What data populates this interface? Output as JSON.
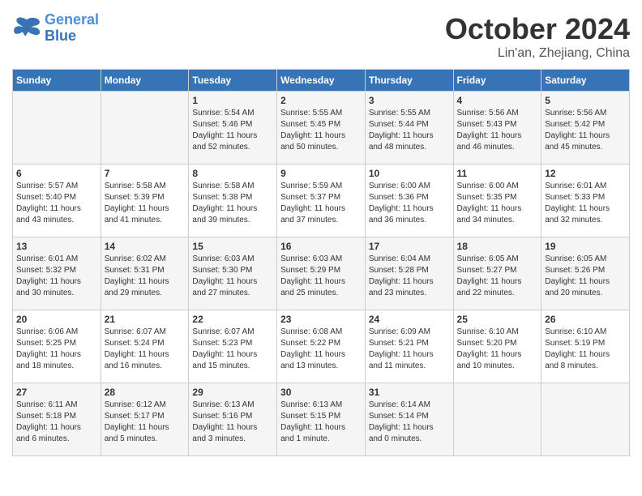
{
  "header": {
    "logo_line1": "General",
    "logo_line2": "Blue",
    "month": "October 2024",
    "location": "Lin'an, Zhejiang, China"
  },
  "days_of_week": [
    "Sunday",
    "Monday",
    "Tuesday",
    "Wednesday",
    "Thursday",
    "Friday",
    "Saturday"
  ],
  "weeks": [
    [
      {
        "day": "",
        "info": ""
      },
      {
        "day": "",
        "info": ""
      },
      {
        "day": "1",
        "info": "Sunrise: 5:54 AM\nSunset: 5:46 PM\nDaylight: 11 hours\nand 52 minutes."
      },
      {
        "day": "2",
        "info": "Sunrise: 5:55 AM\nSunset: 5:45 PM\nDaylight: 11 hours\nand 50 minutes."
      },
      {
        "day": "3",
        "info": "Sunrise: 5:55 AM\nSunset: 5:44 PM\nDaylight: 11 hours\nand 48 minutes."
      },
      {
        "day": "4",
        "info": "Sunrise: 5:56 AM\nSunset: 5:43 PM\nDaylight: 11 hours\nand 46 minutes."
      },
      {
        "day": "5",
        "info": "Sunrise: 5:56 AM\nSunset: 5:42 PM\nDaylight: 11 hours\nand 45 minutes."
      }
    ],
    [
      {
        "day": "6",
        "info": "Sunrise: 5:57 AM\nSunset: 5:40 PM\nDaylight: 11 hours\nand 43 minutes."
      },
      {
        "day": "7",
        "info": "Sunrise: 5:58 AM\nSunset: 5:39 PM\nDaylight: 11 hours\nand 41 minutes."
      },
      {
        "day": "8",
        "info": "Sunrise: 5:58 AM\nSunset: 5:38 PM\nDaylight: 11 hours\nand 39 minutes."
      },
      {
        "day": "9",
        "info": "Sunrise: 5:59 AM\nSunset: 5:37 PM\nDaylight: 11 hours\nand 37 minutes."
      },
      {
        "day": "10",
        "info": "Sunrise: 6:00 AM\nSunset: 5:36 PM\nDaylight: 11 hours\nand 36 minutes."
      },
      {
        "day": "11",
        "info": "Sunrise: 6:00 AM\nSunset: 5:35 PM\nDaylight: 11 hours\nand 34 minutes."
      },
      {
        "day": "12",
        "info": "Sunrise: 6:01 AM\nSunset: 5:33 PM\nDaylight: 11 hours\nand 32 minutes."
      }
    ],
    [
      {
        "day": "13",
        "info": "Sunrise: 6:01 AM\nSunset: 5:32 PM\nDaylight: 11 hours\nand 30 minutes."
      },
      {
        "day": "14",
        "info": "Sunrise: 6:02 AM\nSunset: 5:31 PM\nDaylight: 11 hours\nand 29 minutes."
      },
      {
        "day": "15",
        "info": "Sunrise: 6:03 AM\nSunset: 5:30 PM\nDaylight: 11 hours\nand 27 minutes."
      },
      {
        "day": "16",
        "info": "Sunrise: 6:03 AM\nSunset: 5:29 PM\nDaylight: 11 hours\nand 25 minutes."
      },
      {
        "day": "17",
        "info": "Sunrise: 6:04 AM\nSunset: 5:28 PM\nDaylight: 11 hours\nand 23 minutes."
      },
      {
        "day": "18",
        "info": "Sunrise: 6:05 AM\nSunset: 5:27 PM\nDaylight: 11 hours\nand 22 minutes."
      },
      {
        "day": "19",
        "info": "Sunrise: 6:05 AM\nSunset: 5:26 PM\nDaylight: 11 hours\nand 20 minutes."
      }
    ],
    [
      {
        "day": "20",
        "info": "Sunrise: 6:06 AM\nSunset: 5:25 PM\nDaylight: 11 hours\nand 18 minutes."
      },
      {
        "day": "21",
        "info": "Sunrise: 6:07 AM\nSunset: 5:24 PM\nDaylight: 11 hours\nand 16 minutes."
      },
      {
        "day": "22",
        "info": "Sunrise: 6:07 AM\nSunset: 5:23 PM\nDaylight: 11 hours\nand 15 minutes."
      },
      {
        "day": "23",
        "info": "Sunrise: 6:08 AM\nSunset: 5:22 PM\nDaylight: 11 hours\nand 13 minutes."
      },
      {
        "day": "24",
        "info": "Sunrise: 6:09 AM\nSunset: 5:21 PM\nDaylight: 11 hours\nand 11 minutes."
      },
      {
        "day": "25",
        "info": "Sunrise: 6:10 AM\nSunset: 5:20 PM\nDaylight: 11 hours\nand 10 minutes."
      },
      {
        "day": "26",
        "info": "Sunrise: 6:10 AM\nSunset: 5:19 PM\nDaylight: 11 hours\nand 8 minutes."
      }
    ],
    [
      {
        "day": "27",
        "info": "Sunrise: 6:11 AM\nSunset: 5:18 PM\nDaylight: 11 hours\nand 6 minutes."
      },
      {
        "day": "28",
        "info": "Sunrise: 6:12 AM\nSunset: 5:17 PM\nDaylight: 11 hours\nand 5 minutes."
      },
      {
        "day": "29",
        "info": "Sunrise: 6:13 AM\nSunset: 5:16 PM\nDaylight: 11 hours\nand 3 minutes."
      },
      {
        "day": "30",
        "info": "Sunrise: 6:13 AM\nSunset: 5:15 PM\nDaylight: 11 hours\nand 1 minute."
      },
      {
        "day": "31",
        "info": "Sunrise: 6:14 AM\nSunset: 5:14 PM\nDaylight: 11 hours\nand 0 minutes."
      },
      {
        "day": "",
        "info": ""
      },
      {
        "day": "",
        "info": ""
      }
    ]
  ]
}
